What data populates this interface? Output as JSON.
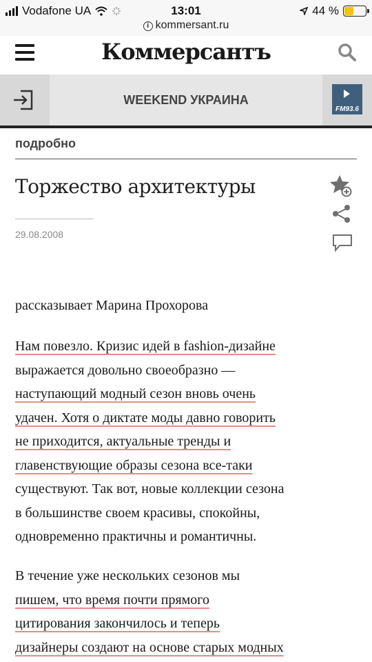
{
  "status": {
    "carrier": "Vodafone UA",
    "time": "13:01",
    "battery": "44 %",
    "battery_level": 0.44
  },
  "browser": {
    "url": "kommersant.ru"
  },
  "masthead": {
    "logo": "Коммерсантъ"
  },
  "section": {
    "title": "WEEKEND УКРАИНА",
    "radio_label": "FM93.6"
  },
  "article": {
    "rubric": "подробно",
    "title": "Торжество архитектуры",
    "date": "29.08.2008",
    "author": "рассказывает Марина Прохорова",
    "para1": [
      "Нам повезло. Кризис идей в fashion-дизайне",
      "выражается довольно своеобразно —",
      "наступающий модный сезон вновь очень",
      "удачен. Хотя о диктате моды давно говорить",
      "не приходится, актуальные тренды и",
      "главенствующие образы сезона все-таки",
      "существуют. Так вот, новые коллекции сезона",
      "в большинстве своем красивы, спокойны,",
      "одновременно практичны и романтичны."
    ],
    "para2": [
      "В течение уже нескольких сезонов мы",
      "пишем, что время почти прямого",
      "цитирования закончилось и теперь",
      "дизайнеры создают на основе старых модных"
    ]
  },
  "colors": {
    "highlight": "#e88a8a",
    "radio": "#3f5f7d",
    "battery": "#f1c40f"
  }
}
